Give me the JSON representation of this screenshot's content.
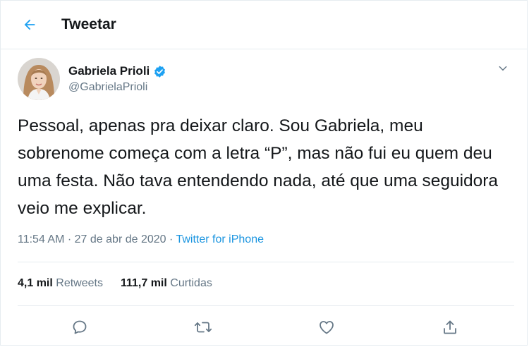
{
  "header": {
    "title": "Tweetar",
    "back_icon": "arrow-left-icon"
  },
  "author": {
    "name": "Gabriela Prioli",
    "handle": "@GabrielaPrioli",
    "verified": true
  },
  "tweet": {
    "text": "Pessoal, apenas pra deixar claro. Sou Gabriela, meu sobrenome começa com a letra “P”, mas não fui eu quem deu uma festa. Não tava entendendo nada, até que uma seguidora veio me explicar.",
    "time": "11:54 AM",
    "separator": "·",
    "date": "27 de abr de 2020",
    "source": "Twitter for iPhone"
  },
  "stats": {
    "retweets_count": "4,1 mil",
    "retweets_label": "Retweets",
    "likes_count": "111,7 mil",
    "likes_label": "Curtidas"
  },
  "actions": [
    "reply-icon",
    "retweet-icon",
    "like-icon",
    "share-icon"
  ],
  "colors": {
    "accent": "#1da1f2",
    "link": "#1b95e0",
    "secondary_text": "#657786",
    "primary_text": "#14171a",
    "border": "#e6ecf0"
  }
}
